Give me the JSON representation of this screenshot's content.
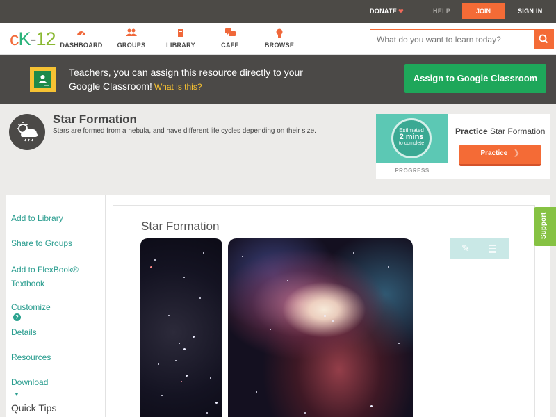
{
  "topbar": {
    "donate": "DONATE",
    "help": "HELP",
    "join": "JOIN",
    "sign_in": "SIGN IN"
  },
  "logo": {
    "c": "c",
    "k": "K",
    "dash": "-",
    "n": "12"
  },
  "nav": {
    "items": [
      {
        "label": "DASHBOARD",
        "icon": "dashboard-icon"
      },
      {
        "label": "GROUPS",
        "icon": "groups-icon"
      },
      {
        "label": "LIBRARY",
        "icon": "library-icon"
      },
      {
        "label": "CAFE",
        "icon": "cafe-icon"
      },
      {
        "label": "BROWSE",
        "icon": "browse-icon"
      }
    ]
  },
  "search": {
    "placeholder": "What do you want to learn today?",
    "value": ""
  },
  "banner": {
    "text": "Teachers, you can assign this resource directly to your Google Classroom!",
    "what_link": "What is this?",
    "assign_button": "Assign to Google Classroom"
  },
  "concept": {
    "title": "Star Formation",
    "description": "Stars are formed from a nebula, and have different life cycles depending on their size."
  },
  "practice": {
    "estimated": "Estimated",
    "minutes": "2 mins",
    "to_complete": "to complete",
    "progress": "PROGRESS",
    "title_bold": "Practice",
    "title_rest": "Star Formation",
    "button": "Practice"
  },
  "sidebar": {
    "items": [
      {
        "label": "Add to Library"
      },
      {
        "label": "Share to Groups"
      },
      {
        "label": "Add to FlexBook® Textbook"
      },
      {
        "label": "Customize"
      },
      {
        "label": "Details"
      },
      {
        "label": "Resources"
      },
      {
        "label": "Download"
      }
    ],
    "help_glyph": "?",
    "quick_tips": "Quick Tips"
  },
  "content": {
    "title": "Star Formation"
  },
  "support": "Support",
  "colors": {
    "accent": "#f46b36",
    "teal": "#2a9d8f",
    "google_green": "#1ea75a",
    "banner_bg": "#4b4947",
    "support_green": "#86c243"
  }
}
